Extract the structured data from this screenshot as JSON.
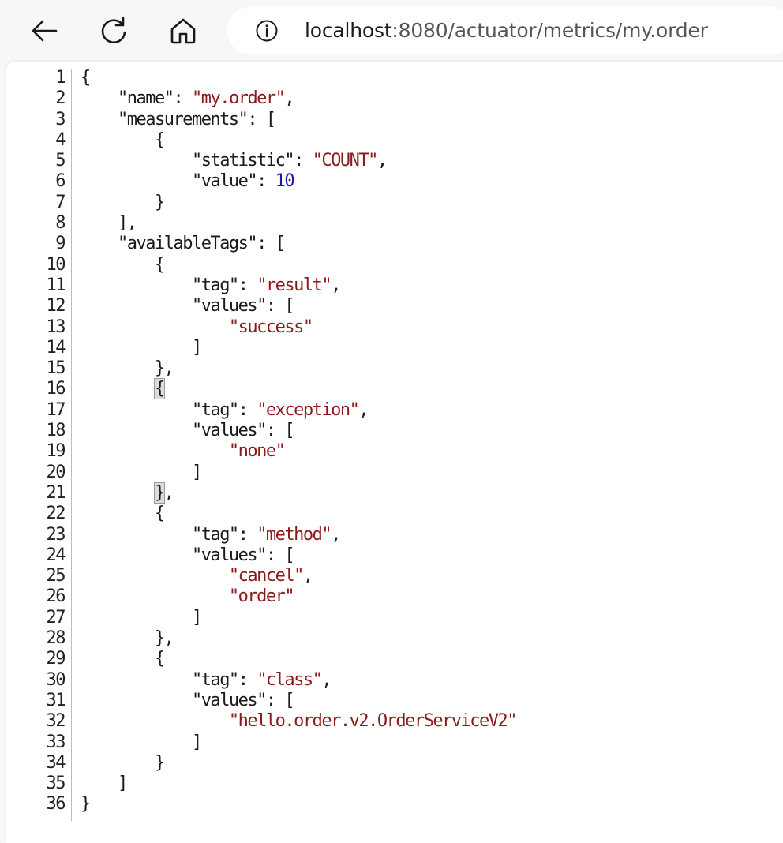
{
  "browser": {
    "url_host": "localhost",
    "url_rest": ":8080/actuator/metrics/my.order",
    "back_icon": "arrow-left-icon",
    "reload_icon": "reload-icon",
    "home_icon": "home-icon",
    "info_icon": "info-icon"
  },
  "json_view": {
    "lines": [
      {
        "n": "1",
        "segs": [
          {
            "t": "{",
            "c": "p"
          }
        ]
      },
      {
        "n": "2",
        "segs": [
          {
            "t": "    ",
            "c": "p"
          },
          {
            "t": "\"name\"",
            "c": "k"
          },
          {
            "t": ": ",
            "c": "p"
          },
          {
            "t": "\"my.order\"",
            "c": "s"
          },
          {
            "t": ",",
            "c": "p"
          }
        ]
      },
      {
        "n": "3",
        "segs": [
          {
            "t": "    ",
            "c": "p"
          },
          {
            "t": "\"measurements\"",
            "c": "k"
          },
          {
            "t": ": [",
            "c": "p"
          }
        ]
      },
      {
        "n": "4",
        "segs": [
          {
            "t": "        {",
            "c": "p"
          }
        ]
      },
      {
        "n": "5",
        "segs": [
          {
            "t": "            ",
            "c": "p"
          },
          {
            "t": "\"statistic\"",
            "c": "k"
          },
          {
            "t": ": ",
            "c": "p"
          },
          {
            "t": "\"COUNT\"",
            "c": "s"
          },
          {
            "t": ",",
            "c": "p"
          }
        ]
      },
      {
        "n": "6",
        "segs": [
          {
            "t": "            ",
            "c": "p"
          },
          {
            "t": "\"value\"",
            "c": "k"
          },
          {
            "t": ": ",
            "c": "p"
          },
          {
            "t": "10",
            "c": "n"
          }
        ]
      },
      {
        "n": "7",
        "segs": [
          {
            "t": "        }",
            "c": "p"
          }
        ]
      },
      {
        "n": "8",
        "segs": [
          {
            "t": "    ],",
            "c": "p"
          }
        ]
      },
      {
        "n": "9",
        "segs": [
          {
            "t": "    ",
            "c": "p"
          },
          {
            "t": "\"availableTags\"",
            "c": "k"
          },
          {
            "t": ": [",
            "c": "p"
          }
        ]
      },
      {
        "n": "10",
        "segs": [
          {
            "t": "        {",
            "c": "p"
          }
        ]
      },
      {
        "n": "11",
        "segs": [
          {
            "t": "            ",
            "c": "p"
          },
          {
            "t": "\"tag\"",
            "c": "k"
          },
          {
            "t": ": ",
            "c": "p"
          },
          {
            "t": "\"result\"",
            "c": "s"
          },
          {
            "t": ",",
            "c": "p"
          }
        ]
      },
      {
        "n": "12",
        "segs": [
          {
            "t": "            ",
            "c": "p"
          },
          {
            "t": "\"values\"",
            "c": "k"
          },
          {
            "t": ": [",
            "c": "p"
          }
        ]
      },
      {
        "n": "13",
        "segs": [
          {
            "t": "                ",
            "c": "p"
          },
          {
            "t": "\"success\"",
            "c": "s"
          }
        ]
      },
      {
        "n": "14",
        "segs": [
          {
            "t": "            ]",
            "c": "p"
          }
        ]
      },
      {
        "n": "15",
        "segs": [
          {
            "t": "        },",
            "c": "p"
          }
        ]
      },
      {
        "n": "16",
        "segs": [
          {
            "t": "        ",
            "c": "p"
          },
          {
            "t": "{",
            "c": "h"
          }
        ]
      },
      {
        "n": "17",
        "segs": [
          {
            "t": "            ",
            "c": "p"
          },
          {
            "t": "\"tag\"",
            "c": "k"
          },
          {
            "t": ": ",
            "c": "p"
          },
          {
            "t": "\"exception\"",
            "c": "s"
          },
          {
            "t": ",",
            "c": "p"
          }
        ]
      },
      {
        "n": "18",
        "segs": [
          {
            "t": "            ",
            "c": "p"
          },
          {
            "t": "\"values\"",
            "c": "k"
          },
          {
            "t": ": [",
            "c": "p"
          }
        ]
      },
      {
        "n": "19",
        "segs": [
          {
            "t": "                ",
            "c": "p"
          },
          {
            "t": "\"none\"",
            "c": "s"
          }
        ]
      },
      {
        "n": "20",
        "segs": [
          {
            "t": "            ]",
            "c": "p"
          }
        ]
      },
      {
        "n": "21",
        "segs": [
          {
            "t": "        ",
            "c": "p"
          },
          {
            "t": "}",
            "c": "h"
          },
          {
            "t": ",",
            "c": "p"
          }
        ]
      },
      {
        "n": "22",
        "segs": [
          {
            "t": "        {",
            "c": "p"
          }
        ]
      },
      {
        "n": "23",
        "segs": [
          {
            "t": "            ",
            "c": "p"
          },
          {
            "t": "\"tag\"",
            "c": "k"
          },
          {
            "t": ": ",
            "c": "p"
          },
          {
            "t": "\"method\"",
            "c": "s"
          },
          {
            "t": ",",
            "c": "p"
          }
        ]
      },
      {
        "n": "24",
        "segs": [
          {
            "t": "            ",
            "c": "p"
          },
          {
            "t": "\"values\"",
            "c": "k"
          },
          {
            "t": ": [",
            "c": "p"
          }
        ]
      },
      {
        "n": "25",
        "segs": [
          {
            "t": "                ",
            "c": "p"
          },
          {
            "t": "\"cancel\"",
            "c": "s"
          },
          {
            "t": ",",
            "c": "p"
          }
        ]
      },
      {
        "n": "26",
        "segs": [
          {
            "t": "                ",
            "c": "p"
          },
          {
            "t": "\"order\"",
            "c": "s"
          }
        ]
      },
      {
        "n": "27",
        "segs": [
          {
            "t": "            ]",
            "c": "p"
          }
        ]
      },
      {
        "n": "28",
        "segs": [
          {
            "t": "        },",
            "c": "p"
          }
        ]
      },
      {
        "n": "29",
        "segs": [
          {
            "t": "        {",
            "c": "p"
          }
        ]
      },
      {
        "n": "30",
        "segs": [
          {
            "t": "            ",
            "c": "p"
          },
          {
            "t": "\"tag\"",
            "c": "k"
          },
          {
            "t": ": ",
            "c": "p"
          },
          {
            "t": "\"class\"",
            "c": "s"
          },
          {
            "t": ",",
            "c": "p"
          }
        ]
      },
      {
        "n": "31",
        "segs": [
          {
            "t": "            ",
            "c": "p"
          },
          {
            "t": "\"values\"",
            "c": "k"
          },
          {
            "t": ": [",
            "c": "p"
          }
        ]
      },
      {
        "n": "32",
        "segs": [
          {
            "t": "                ",
            "c": "p"
          },
          {
            "t": "\"hello.order.v2.OrderServiceV2\"",
            "c": "s"
          }
        ]
      },
      {
        "n": "33",
        "segs": [
          {
            "t": "            ]",
            "c": "p"
          }
        ]
      },
      {
        "n": "34",
        "segs": [
          {
            "t": "        }",
            "c": "p"
          }
        ]
      },
      {
        "n": "35",
        "segs": [
          {
            "t": "    ]",
            "c": "p"
          }
        ]
      },
      {
        "n": "36",
        "segs": [
          {
            "t": "}",
            "c": "p"
          }
        ]
      }
    ]
  },
  "colors": {
    "string": "#8b1a1a",
    "number": "#1a1aa6",
    "key": "#1a1a1a",
    "toolbar_bg": "#f7f7f7"
  }
}
